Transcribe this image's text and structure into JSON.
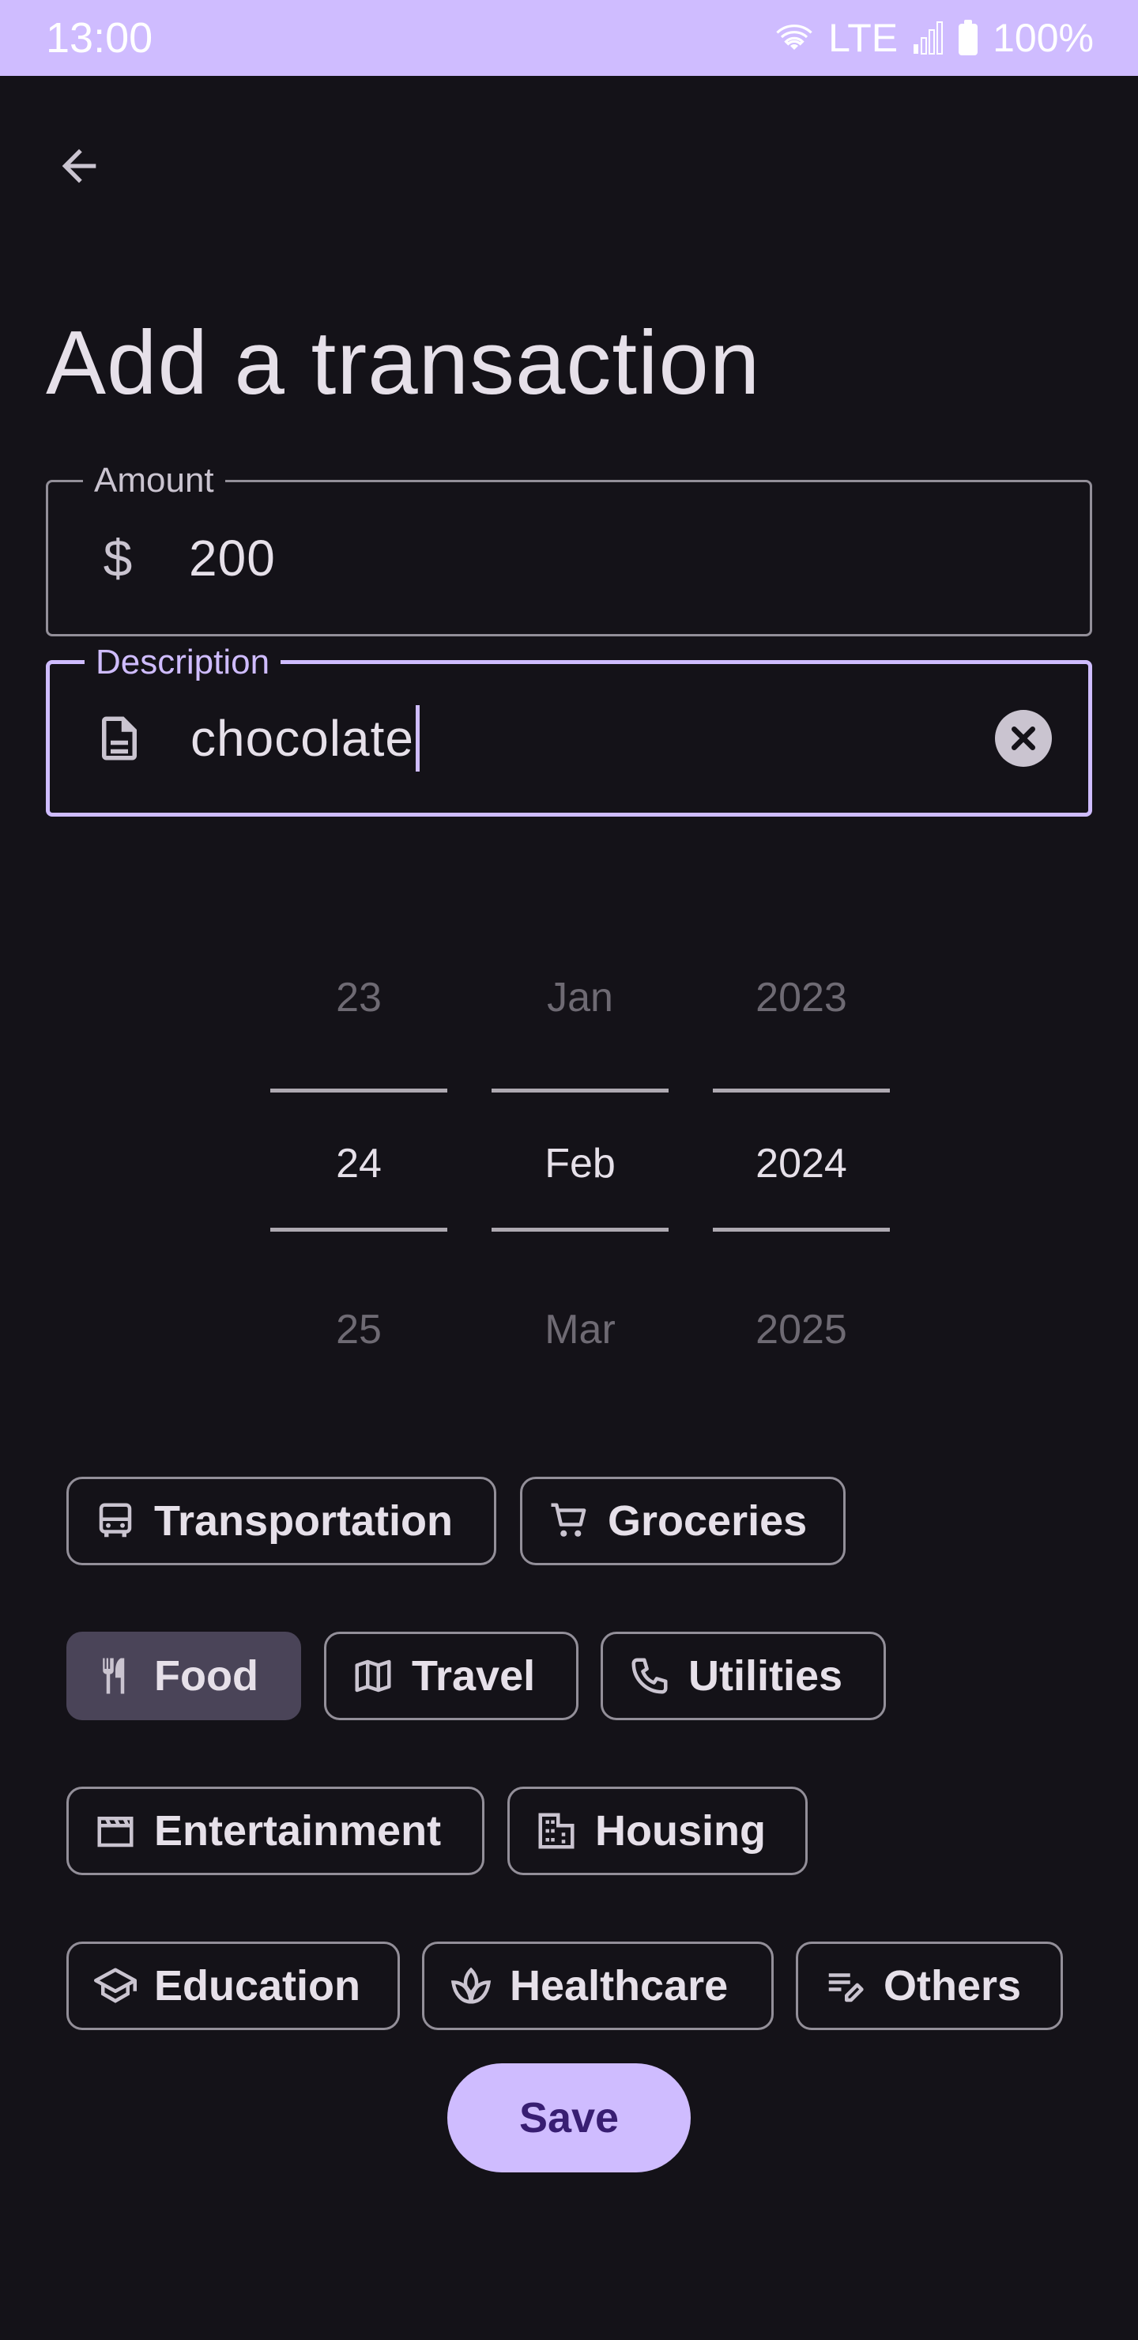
{
  "status_bar": {
    "time": "13:00",
    "network": "LTE",
    "battery": "100%"
  },
  "header": {
    "back_icon": "arrow-back-icon"
  },
  "page": {
    "title": "Add a transaction"
  },
  "form": {
    "amount": {
      "label": "Amount",
      "icon": "dollar-icon",
      "prefix": "$",
      "value": "200"
    },
    "description": {
      "label": "Description",
      "icon": "document-icon",
      "value": "chocolate",
      "clear_icon": "cancel-icon"
    }
  },
  "date_picker": {
    "day": {
      "prev": "23",
      "current": "24",
      "next": "25"
    },
    "month": {
      "prev": "Jan",
      "current": "Feb",
      "next": "Mar"
    },
    "year": {
      "prev": "2023",
      "current": "2024",
      "next": "2025"
    }
  },
  "categories": [
    {
      "label": "Transportation",
      "icon": "bus-icon",
      "selected": false
    },
    {
      "label": "Groceries",
      "icon": "cart-icon",
      "selected": false
    },
    {
      "label": "Food",
      "icon": "restaurant-icon",
      "selected": true
    },
    {
      "label": "Travel",
      "icon": "map-icon",
      "selected": false
    },
    {
      "label": "Utilities",
      "icon": "phone-icon",
      "selected": false
    },
    {
      "label": "Entertainment",
      "icon": "movie-icon",
      "selected": false
    },
    {
      "label": "Housing",
      "icon": "building-icon",
      "selected": false
    },
    {
      "label": "Education",
      "icon": "school-icon",
      "selected": false
    },
    {
      "label": "Healthcare",
      "icon": "spa-icon",
      "selected": false
    },
    {
      "label": "Others",
      "icon": "edit-note-icon",
      "selected": false
    }
  ],
  "actions": {
    "save_label": "Save"
  },
  "colors": {
    "background": "#141218",
    "accent": "#CFBCFF",
    "chip_selected": "#4A4458",
    "on_accent": "#381E72"
  }
}
